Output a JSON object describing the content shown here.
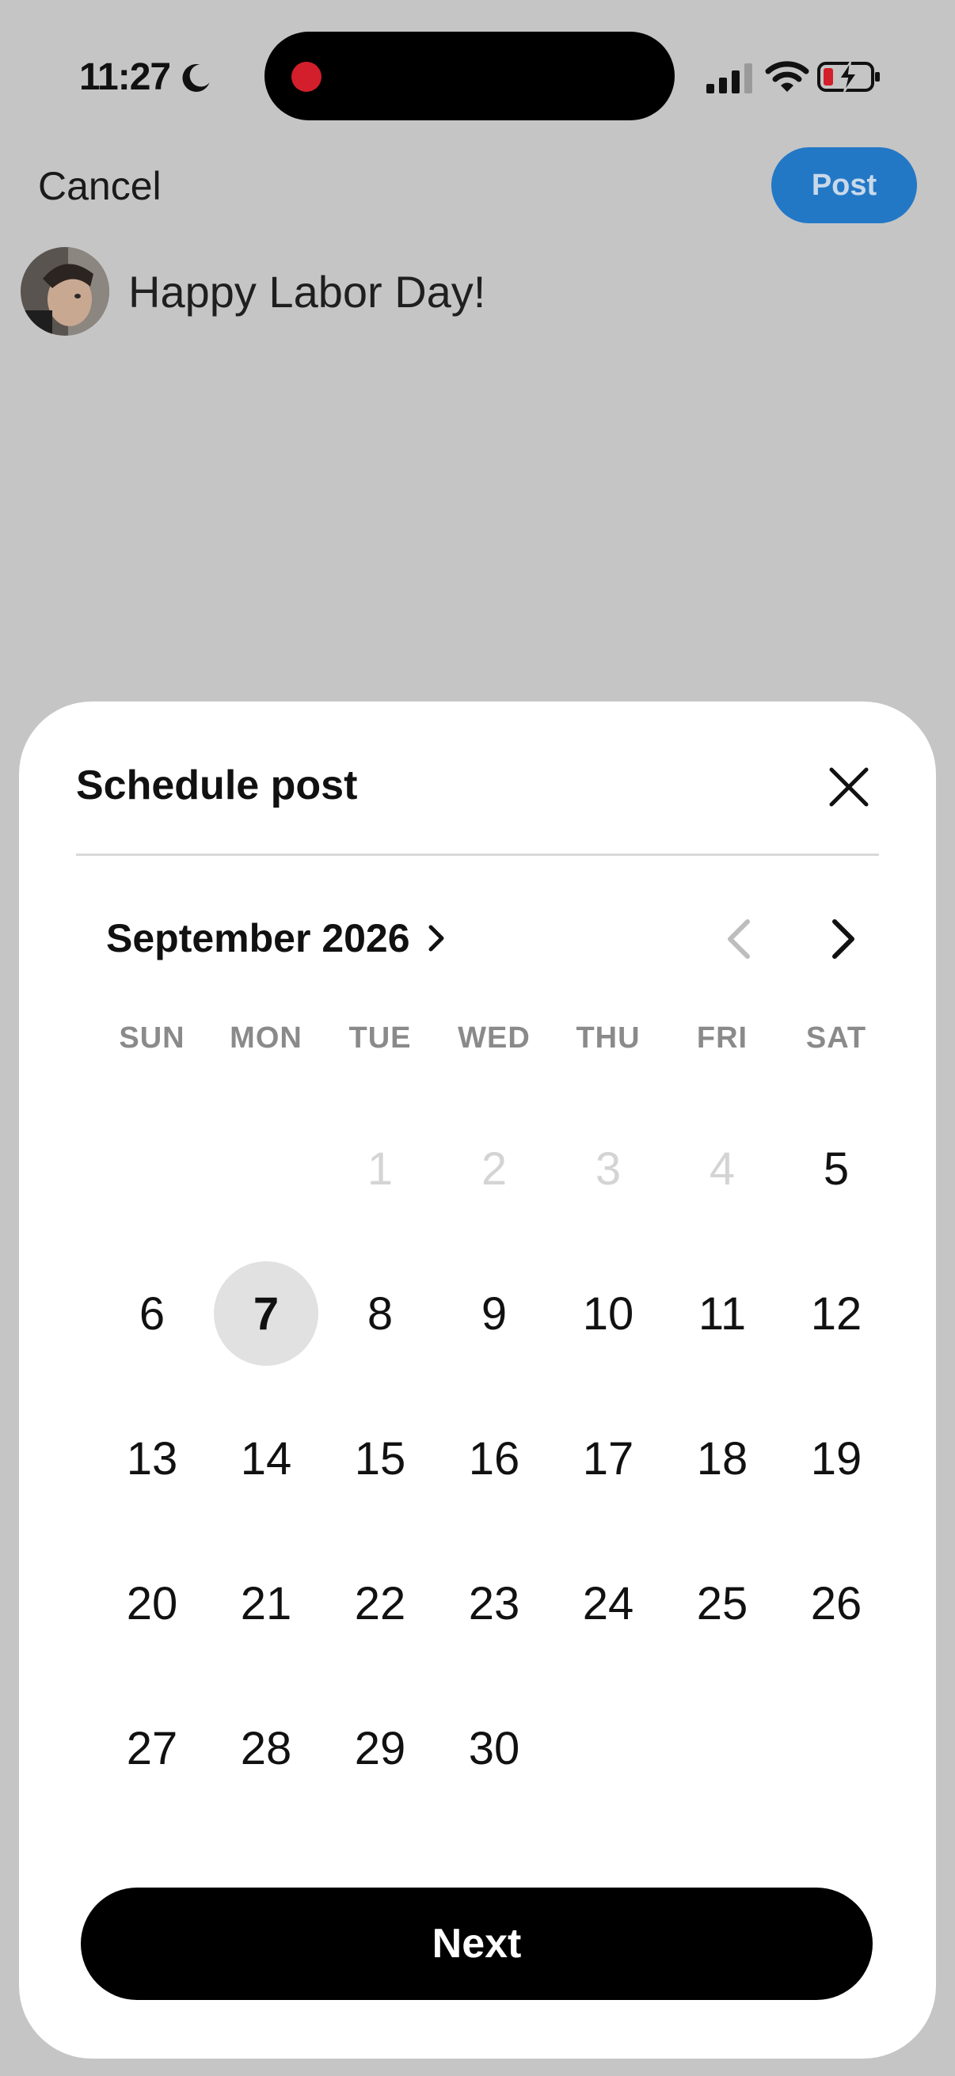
{
  "status_bar": {
    "time": "11:27",
    "icons": [
      "moon-icon",
      "recording-dot",
      "signal-icon",
      "wifi-icon",
      "battery-charging-icon"
    ]
  },
  "compose": {
    "cancel_label": "Cancel",
    "post_label": "Post",
    "text": "Happy Labor Day!"
  },
  "schedule_sheet": {
    "title": "Schedule post",
    "month_label": "September 2026",
    "weekdays": [
      "SUN",
      "MON",
      "TUE",
      "WED",
      "THU",
      "FRI",
      "SAT"
    ],
    "days": [
      {
        "label": "",
        "state": "empty"
      },
      {
        "label": "",
        "state": "empty"
      },
      {
        "label": "1",
        "state": "disabled"
      },
      {
        "label": "2",
        "state": "disabled"
      },
      {
        "label": "3",
        "state": "disabled"
      },
      {
        "label": "4",
        "state": "disabled"
      },
      {
        "label": "5",
        "state": "enabled"
      },
      {
        "label": "6",
        "state": "enabled"
      },
      {
        "label": "7",
        "state": "selected"
      },
      {
        "label": "8",
        "state": "enabled"
      },
      {
        "label": "9",
        "state": "enabled"
      },
      {
        "label": "10",
        "state": "enabled"
      },
      {
        "label": "11",
        "state": "enabled"
      },
      {
        "label": "12",
        "state": "enabled"
      },
      {
        "label": "13",
        "state": "enabled"
      },
      {
        "label": "14",
        "state": "enabled"
      },
      {
        "label": "15",
        "state": "enabled"
      },
      {
        "label": "16",
        "state": "enabled"
      },
      {
        "label": "17",
        "state": "enabled"
      },
      {
        "label": "18",
        "state": "enabled"
      },
      {
        "label": "19",
        "state": "enabled"
      },
      {
        "label": "20",
        "state": "enabled"
      },
      {
        "label": "21",
        "state": "enabled"
      },
      {
        "label": "22",
        "state": "enabled"
      },
      {
        "label": "23",
        "state": "enabled"
      },
      {
        "label": "24",
        "state": "enabled"
      },
      {
        "label": "25",
        "state": "enabled"
      },
      {
        "label": "26",
        "state": "enabled"
      },
      {
        "label": "27",
        "state": "enabled"
      },
      {
        "label": "28",
        "state": "enabled"
      },
      {
        "label": "29",
        "state": "enabled"
      },
      {
        "label": "30",
        "state": "enabled"
      }
    ],
    "next_label": "Next"
  },
  "colors": {
    "accent_blue": "#2378c6",
    "recording_red": "#d21f2b",
    "selected_day_bg": "#e1e1e1",
    "disabled_day": "#d4d4d4",
    "overlay": "#c5c5c5"
  }
}
